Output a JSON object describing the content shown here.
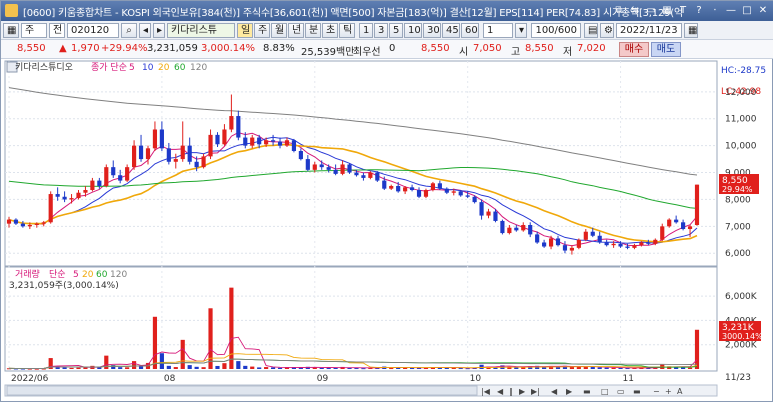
{
  "titlebar": {
    "text": "[0600] 키움종합차트 - KOSPI 외국인보유[384(천)] 주식수[36,601(천)] 액면[500] 자본금[183(억)] 결산[12월] EPS[114] PER[74.83] 시가총액[3,129(억",
    "ctrl_icons": [
      "copy-icon",
      "link-icon",
      "window-icon",
      "table-icon",
      "link2-icon",
      "font-icon",
      "help-icon",
      "minimize-icon",
      "maximize-icon",
      "close-icon"
    ]
  },
  "toolbar": {
    "market": "주",
    "prefix": "전",
    "code": "020120",
    "stock_name": "키다리스튜",
    "periods": [
      "일",
      "주",
      "월",
      "년",
      "분",
      "초",
      "틱"
    ],
    "active_period": "일",
    "intervals": [
      "1",
      "3",
      "5",
      "10",
      "30",
      "45",
      "60"
    ],
    "interval_input": "1",
    "count": "100/600",
    "date": "2022/11/23"
  },
  "quote": {
    "price": "8,550",
    "change": "1,970",
    "change_pct": "+29.94%",
    "volume": "3,231,059",
    "vol_ratio": "3,000.14%",
    "turnover": "8.83%",
    "amount": "25,539백만",
    "best_label": "최우선",
    "best_value": "0",
    "ohlc_price": "8,550",
    "open_label": "시",
    "open": "7,050",
    "high_label": "고",
    "high": "8,550",
    "low_label": "저",
    "low": "7,020",
    "buy": "매수",
    "sell": "매도"
  },
  "price_pane": {
    "legend_name": "키다리스튜디오",
    "legend_ma": "종가 단순",
    "ma_periods": [
      "5",
      "10",
      "20",
      "60",
      "120"
    ],
    "ma_colors": [
      "#d6197a",
      "#2b3bd6",
      "#f0a80a",
      "#21a82f",
      "#808080"
    ],
    "lc": "LC:42.98",
    "hc": "HC:-28.75",
    "last_price": "8,550",
    "last_pct": "29.94%",
    "y_ticks": [
      "12,000",
      "11,000",
      "10,000",
      "9,000",
      "8,000",
      "7,000",
      "6,000"
    ]
  },
  "volume_pane": {
    "legend_name": "거래량",
    "legend_ma": "단순",
    "ma_periods": [
      "5",
      "20",
      "60",
      "120"
    ],
    "value_line": "3,231,059주(3,000.14%)",
    "last_vol": "3,231K",
    "last_pct": "3000.14%",
    "y_ticks": [
      "6,000K",
      "4,000K",
      "2,000K"
    ]
  },
  "x_axis": {
    "labels": [
      "2022/06",
      "08",
      "09",
      "10",
      "11"
    ],
    "last_date": "11/23"
  },
  "chart_data": [
    {
      "type": "candlestick",
      "title": "키다리스튜디오",
      "ylim": [
        5600,
        12700
      ],
      "candles": [
        [
          7100,
          7350,
          6950,
          7250
        ],
        [
          7250,
          7300,
          7050,
          7100
        ],
        [
          7100,
          7200,
          6950,
          7000
        ],
        [
          7000,
          7150,
          6900,
          7050
        ],
        [
          7050,
          7150,
          6950,
          7100
        ],
        [
          7100,
          7200,
          7000,
          7150
        ],
        [
          7150,
          8300,
          7100,
          8200
        ],
        [
          8200,
          8450,
          7950,
          8100
        ],
        [
          8100,
          8300,
          7900,
          8000
        ],
        [
          8000,
          8200,
          7850,
          8050
        ],
        [
          8050,
          8350,
          8000,
          8250
        ],
        [
          8250,
          8500,
          8100,
          8350
        ],
        [
          8350,
          8800,
          8300,
          8700
        ],
        [
          8700,
          8800,
          8400,
          8500
        ],
        [
          8500,
          9300,
          8450,
          9200
        ],
        [
          9200,
          9450,
          8800,
          8900
        ],
        [
          8900,
          9100,
          8600,
          8700
        ],
        [
          8700,
          9300,
          8650,
          9200
        ],
        [
          9200,
          10200,
          9100,
          10000
        ],
        [
          10000,
          10400,
          9400,
          9500
        ],
        [
          9500,
          10000,
          9300,
          9900
        ],
        [
          9900,
          10900,
          9800,
          10600
        ],
        [
          10600,
          10900,
          9800,
          9900
        ],
        [
          9900,
          10100,
          9300,
          9400
        ],
        [
          9400,
          9700,
          9150,
          9500
        ],
        [
          9500,
          10900,
          9400,
          10000
        ],
        [
          10000,
          10300,
          9300,
          9400
        ],
        [
          9400,
          9600,
          9050,
          9200
        ],
        [
          9200,
          9700,
          9150,
          9600
        ],
        [
          9600,
          10600,
          9500,
          10400
        ],
        [
          10400,
          10500,
          9950,
          10050
        ],
        [
          10050,
          10800,
          10000,
          10600
        ],
        [
          10600,
          11900,
          10500,
          11100
        ],
        [
          11100,
          11300,
          10200,
          10300
        ],
        [
          10300,
          10500,
          9900,
          10000
        ],
        [
          10000,
          10400,
          9900,
          10300
        ],
        [
          10300,
          10400,
          9900,
          10050
        ],
        [
          10050,
          10300,
          9950,
          10200
        ],
        [
          10200,
          10400,
          10000,
          10150
        ],
        [
          10150,
          10300,
          9900,
          10000
        ],
        [
          10000,
          10300,
          9950,
          10200
        ],
        [
          10200,
          10250,
          9750,
          9800
        ],
        [
          9800,
          9900,
          9450,
          9500
        ],
        [
          9500,
          9650,
          9050,
          9100
        ],
        [
          9100,
          9400,
          9000,
          9300
        ],
        [
          9300,
          9450,
          9100,
          9200
        ],
        [
          9200,
          9300,
          9000,
          9100
        ],
        [
          9100,
          9300,
          8900,
          8950
        ],
        [
          8950,
          9450,
          8900,
          9300
        ],
        [
          9300,
          9350,
          8950,
          9000
        ],
        [
          9000,
          9100,
          8850,
          8900
        ],
        [
          8900,
          9000,
          8700,
          8800
        ],
        [
          8800,
          9050,
          8750,
          9000
        ],
        [
          9000,
          9050,
          8650,
          8700
        ],
        [
          8700,
          8850,
          8350,
          8400
        ],
        [
          8400,
          8550,
          8350,
          8500
        ],
        [
          8500,
          8650,
          8250,
          8300
        ],
        [
          8300,
          8500,
          8200,
          8450
        ],
        [
          8450,
          8550,
          8300,
          8350
        ],
        [
          8350,
          8450,
          8050,
          8100
        ],
        [
          8100,
          8400,
          8050,
          8350
        ],
        [
          8350,
          8650,
          8300,
          8600
        ],
        [
          8600,
          8700,
          8350,
          8400
        ],
        [
          8400,
          8450,
          8200,
          8250
        ],
        [
          8250,
          8400,
          8150,
          8300
        ],
        [
          8300,
          8350,
          8100,
          8150
        ],
        [
          8150,
          8300,
          8050,
          8100
        ],
        [
          8100,
          8150,
          7850,
          7900
        ],
        [
          7900,
          8000,
          7250,
          7400
        ],
        [
          7400,
          7650,
          7300,
          7550
        ],
        [
          7550,
          7650,
          7150,
          7200
        ],
        [
          7200,
          7250,
          6700,
          6750
        ],
        [
          6750,
          7050,
          6700,
          6950
        ],
        [
          6950,
          7050,
          6800,
          6850
        ],
        [
          6850,
          7150,
          6800,
          7050
        ],
        [
          7050,
          7150,
          6600,
          6700
        ],
        [
          6700,
          6800,
          6350,
          6400
        ],
        [
          6400,
          6500,
          6200,
          6250
        ],
        [
          6250,
          6650,
          6150,
          6550
        ],
        [
          6550,
          6650,
          6250,
          6300
        ],
        [
          6300,
          6450,
          6000,
          6100
        ],
        [
          6100,
          6300,
          5950,
          6200
        ],
        [
          6200,
          6550,
          6150,
          6500
        ],
        [
          6500,
          6900,
          6450,
          6800
        ],
        [
          6800,
          6950,
          6600,
          6650
        ],
        [
          6650,
          6800,
          6350,
          6400
        ],
        [
          6400,
          6500,
          6250,
          6300
        ],
        [
          6300,
          6450,
          6200,
          6350
        ],
        [
          6350,
          6450,
          6200,
          6250
        ],
        [
          6250,
          6350,
          6150,
          6200
        ],
        [
          6200,
          6350,
          6150,
          6300
        ],
        [
          6300,
          6450,
          6250,
          6400
        ],
        [
          6400,
          6500,
          6300,
          6350
        ],
        [
          6350,
          6550,
          6300,
          6500
        ],
        [
          6500,
          7100,
          6450,
          7000
        ],
        [
          7000,
          7300,
          6950,
          7250
        ],
        [
          7250,
          7400,
          7100,
          7150
        ],
        [
          7150,
          7250,
          6850,
          6900
        ],
        [
          6900,
          7050,
          6600,
          7000
        ],
        [
          7050,
          8550,
          7020,
          8550
        ]
      ]
    },
    {
      "type": "bar",
      "title": "거래량",
      "ylim": [
        0,
        7000
      ],
      "values": [
        60,
        45,
        40,
        35,
        30,
        40,
        900,
        220,
        120,
        90,
        110,
        140,
        260,
        130,
        1100,
        320,
        150,
        140,
        650,
        240,
        500,
        4300,
        1300,
        260,
        160,
        2400,
        320,
        180,
        150,
        5000,
        250,
        480,
        6700,
        650,
        260,
        200,
        130,
        160,
        130,
        100,
        120,
        140,
        130,
        180,
        120,
        90,
        80,
        90,
        170,
        100,
        80,
        70,
        90,
        120,
        200,
        80,
        110,
        90,
        80,
        150,
        120,
        160,
        130,
        100,
        90,
        80,
        70,
        120,
        350,
        200,
        180,
        300,
        180,
        140,
        160,
        230,
        260,
        210,
        250,
        160,
        260,
        200,
        170,
        200,
        160,
        130,
        110,
        100,
        90,
        80,
        90,
        110,
        90,
        100,
        360,
        220,
        150,
        120,
        110,
        3231
      ]
    }
  ]
}
